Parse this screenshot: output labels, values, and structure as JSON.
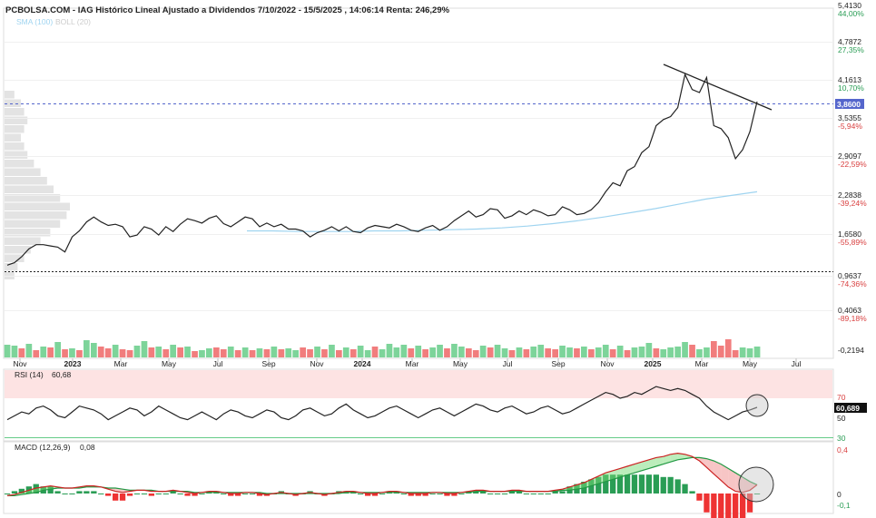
{
  "header": {
    "title": "PCBOLSA.COM - IAG Histórico Lineal Ajustado a Dividendos 7/10/2022 - 15/5/2025 , 14:06:14 Renta: 246,29%",
    "sma_label": "SMA (100)",
    "boll_label": "BOLL (20)"
  },
  "colors": {
    "price": "#222222",
    "sma": "#9fd4f0",
    "up": "#66cc88",
    "down": "#ee6666",
    "pct_pos": "#2a9d55",
    "pct_neg": "#d94040",
    "current": "#5566cc",
    "rsi_band": "#fde3e3",
    "macd_line": "#cc2222",
    "signal_line": "#229944"
  },
  "chart_data": [
    {
      "type": "line",
      "name": "price",
      "x_labels": [
        "Nov",
        "2023",
        "Mar",
        "May",
        "Jul",
        "Sep",
        "Nov",
        "2024",
        "Mar",
        "May",
        "Jul",
        "Sep",
        "Nov",
        "2025",
        "Mar",
        "May",
        "Jul"
      ],
      "y_ticks": [
        {
          "value": "5,4130",
          "pct": "44,00%"
        },
        {
          "value": "4,7872",
          "pct": "27,35%"
        },
        {
          "value": "4,1613",
          "pct": "10,70%"
        },
        {
          "value": "3,5355",
          "pct": "-5,94%"
        },
        {
          "value": "2,9097",
          "pct": "-22,59%"
        },
        {
          "value": "2,2838",
          "pct": "-39,24%"
        },
        {
          "value": "1,6580",
          "pct": "-55,89%"
        },
        {
          "value": "0,9637",
          "pct": "-74,36%"
        },
        {
          "value": "0,4063",
          "pct": "-89,18%"
        },
        {
          "value": "-0,2194",
          "pct": ""
        }
      ],
      "current_value": "3,8600",
      "series": [
        {
          "values": [
            1.08,
            1.12,
            1.22,
            1.35,
            1.42,
            1.42,
            1.4,
            1.38,
            1.3,
            1.55,
            1.65,
            1.8,
            1.88,
            1.8,
            1.74,
            1.76,
            1.72,
            1.55,
            1.58,
            1.72,
            1.68,
            1.58,
            1.72,
            1.64,
            1.76,
            1.85,
            1.82,
            1.78,
            1.86,
            1.9,
            1.77,
            1.72,
            1.8,
            1.88,
            1.85,
            1.72,
            1.78,
            1.72,
            1.76,
            1.68,
            1.68,
            1.65,
            1.55,
            1.62,
            1.66,
            1.72,
            1.65,
            1.72,
            1.64,
            1.62,
            1.7,
            1.74,
            1.72,
            1.7,
            1.76,
            1.72,
            1.66,
            1.64,
            1.7,
            1.74,
            1.66,
            1.72,
            1.82,
            1.9,
            1.98,
            1.88,
            1.92,
            2.02,
            2.0,
            1.86,
            1.9,
            1.98,
            1.92,
            2.0,
            1.96,
            1.9,
            1.92,
            2.05,
            2.0,
            1.92,
            1.94,
            2.0,
            2.12,
            2.3,
            2.45,
            2.4,
            2.65,
            2.72,
            2.95,
            3.05,
            3.4,
            3.5,
            3.55,
            3.7,
            4.25,
            4.0,
            3.95,
            4.2,
            3.4,
            3.35,
            3.2,
            2.85,
            3.0,
            3.3,
            3.8
          ]
        },
        {
          "values": [
            1.65,
            1.65,
            1.64,
            1.64,
            1.64,
            1.65,
            1.65,
            1.66,
            1.67,
            1.68,
            1.7,
            1.73,
            1.77,
            1.82,
            1.88,
            1.95,
            2.02,
            2.1,
            2.18,
            2.24,
            2.3
          ]
        }
      ]
    },
    {
      "type": "bar",
      "name": "volume",
      "values": [
        0.7,
        0.65,
        0.5,
        0.75,
        0.4,
        0.6,
        0.55,
        0.85,
        0.45,
        0.5,
        0.4,
        0.95,
        0.8,
        0.6,
        0.5,
        0.7,
        0.45,
        0.4,
        0.65,
        0.9,
        0.55,
        0.6,
        0.45,
        0.7,
        0.55,
        0.6,
        0.35,
        0.4,
        0.5,
        0.55,
        0.45,
        0.6,
        0.4,
        0.55,
        0.4,
        0.5,
        0.45,
        0.6,
        0.45,
        0.5,
        0.4,
        0.55,
        0.45,
        0.6,
        0.45,
        0.7,
        0.4,
        0.55,
        0.45,
        0.65,
        0.4,
        0.6,
        0.45,
        0.75,
        0.55,
        0.7,
        0.5,
        0.65,
        0.45,
        0.55,
        0.7,
        0.5,
        0.75,
        0.6,
        0.5,
        0.4,
        0.65,
        0.55,
        0.7,
        0.5,
        0.4,
        0.55,
        0.45,
        0.6,
        0.7,
        0.5,
        0.45,
        0.65,
        0.55,
        0.5,
        0.6,
        0.45,
        0.55,
        0.7,
        0.45,
        0.65,
        0.4,
        0.55,
        0.6,
        0.8,
        0.5,
        0.45,
        0.55,
        0.6,
        0.85,
        0.7,
        0.45,
        0.55,
        0.9,
        0.65,
        1.0,
        0.4,
        0.55,
        0.5,
        0.6
      ],
      "up": [
        1,
        1,
        0,
        1,
        0,
        1,
        0,
        1,
        0,
        1,
        0,
        1,
        1,
        0,
        0,
        1,
        0,
        0,
        1,
        1,
        0,
        1,
        0,
        1,
        0,
        1,
        0,
        1,
        1,
        0,
        0,
        1,
        0,
        1,
        0,
        1,
        0,
        1,
        0,
        1,
        1,
        0,
        0,
        1,
        0,
        1,
        0,
        1,
        0,
        1,
        1,
        0,
        1,
        1,
        1,
        1,
        0,
        1,
        0,
        1,
        1,
        0,
        1,
        1,
        0,
        0,
        1,
        0,
        1,
        1,
        0,
        1,
        0,
        1,
        1,
        0,
        0,
        1,
        1,
        0,
        1,
        0,
        1,
        1,
        0,
        1,
        0,
        1,
        1,
        1,
        0,
        1,
        1,
        1,
        1,
        0,
        1,
        1,
        0,
        0,
        0,
        0,
        1,
        1,
        1
      ]
    },
    {
      "type": "line",
      "name": "rsi",
      "label": "RSI (14)",
      "value_label": "60,68",
      "axis_value": "60,689",
      "y_ticks": [
        "70",
        "50",
        "30"
      ],
      "values": [
        48,
        52,
        56,
        54,
        60,
        62,
        58,
        52,
        50,
        56,
        62,
        60,
        58,
        54,
        48,
        52,
        56,
        60,
        58,
        52,
        56,
        62,
        58,
        54,
        50,
        48,
        52,
        56,
        52,
        48,
        54,
        58,
        56,
        52,
        50,
        54,
        58,
        56,
        50,
        48,
        52,
        58,
        60,
        56,
        52,
        54,
        60,
        64,
        58,
        54,
        50,
        52,
        56,
        60,
        62,
        58,
        54,
        50,
        54,
        58,
        60,
        56,
        52,
        56,
        60,
        64,
        62,
        58,
        56,
        60,
        62,
        58,
        54,
        56,
        60,
        62,
        58,
        54,
        56,
        60,
        64,
        68,
        72,
        76,
        74,
        70,
        72,
        76,
        74,
        78,
        82,
        80,
        78,
        80,
        78,
        74,
        70,
        62,
        56,
        52,
        48,
        52,
        56,
        58,
        60.68
      ]
    },
    {
      "type": "line",
      "name": "macd",
      "label": "MACD (12,26,9)",
      "value_label": "0,08",
      "y_ticks": [
        "0,4",
        "0",
        "-0,1"
      ],
      "macd": [
        -0.02,
        -0.01,
        0.01,
        0.03,
        0.05,
        0.06,
        0.07,
        0.06,
        0.05,
        0.05,
        0.06,
        0.07,
        0.07,
        0.06,
        0.04,
        0.02,
        0.01,
        0.02,
        0.03,
        0.03,
        0.02,
        0.02,
        0.02,
        0.03,
        0.02,
        0.01,
        0.0,
        0.01,
        0.02,
        0.02,
        0.01,
        0.0,
        0.0,
        0.01,
        0.01,
        0.0,
        -0.01,
        0.0,
        0.01,
        0.0,
        -0.01,
        0.0,
        0.01,
        0.0,
        -0.01,
        0.0,
        0.01,
        0.02,
        0.02,
        0.01,
        0.0,
        0.0,
        0.01,
        0.02,
        0.02,
        0.01,
        0.0,
        0.0,
        0.0,
        0.01,
        0.01,
        0.0,
        0.0,
        0.01,
        0.02,
        0.03,
        0.03,
        0.02,
        0.02,
        0.02,
        0.03,
        0.03,
        0.02,
        0.02,
        0.02,
        0.02,
        0.03,
        0.04,
        0.06,
        0.08,
        0.1,
        0.13,
        0.16,
        0.19,
        0.21,
        0.23,
        0.25,
        0.27,
        0.29,
        0.31,
        0.33,
        0.34,
        0.36,
        0.37,
        0.36,
        0.34,
        0.3,
        0.24,
        0.18,
        0.12,
        0.06,
        0.02,
        0.01,
        0.03,
        0.08
      ],
      "signal": [
        -0.02,
        -0.02,
        -0.01,
        0.0,
        0.01,
        0.03,
        0.04,
        0.05,
        0.05,
        0.05,
        0.05,
        0.06,
        0.06,
        0.06,
        0.05,
        0.05,
        0.04,
        0.03,
        0.03,
        0.03,
        0.03,
        0.02,
        0.02,
        0.02,
        0.02,
        0.02,
        0.01,
        0.01,
        0.01,
        0.01,
        0.01,
        0.01,
        0.01,
        0.01,
        0.01,
        0.01,
        0.0,
        0.0,
        0.0,
        0.0,
        0.0,
        0.0,
        0.0,
        0.0,
        0.0,
        0.0,
        0.0,
        0.01,
        0.01,
        0.01,
        0.01,
        0.01,
        0.01,
        0.01,
        0.01,
        0.01,
        0.01,
        0.01,
        0.01,
        0.01,
        0.01,
        0.01,
        0.01,
        0.01,
        0.01,
        0.02,
        0.02,
        0.02,
        0.02,
        0.02,
        0.02,
        0.02,
        0.02,
        0.02,
        0.02,
        0.02,
        0.02,
        0.03,
        0.03,
        0.04,
        0.05,
        0.07,
        0.09,
        0.11,
        0.13,
        0.15,
        0.17,
        0.19,
        0.21,
        0.23,
        0.25,
        0.27,
        0.29,
        0.31,
        0.32,
        0.33,
        0.33,
        0.32,
        0.3,
        0.27,
        0.23,
        0.19,
        0.15,
        0.11,
        0.08
      ]
    }
  ]
}
